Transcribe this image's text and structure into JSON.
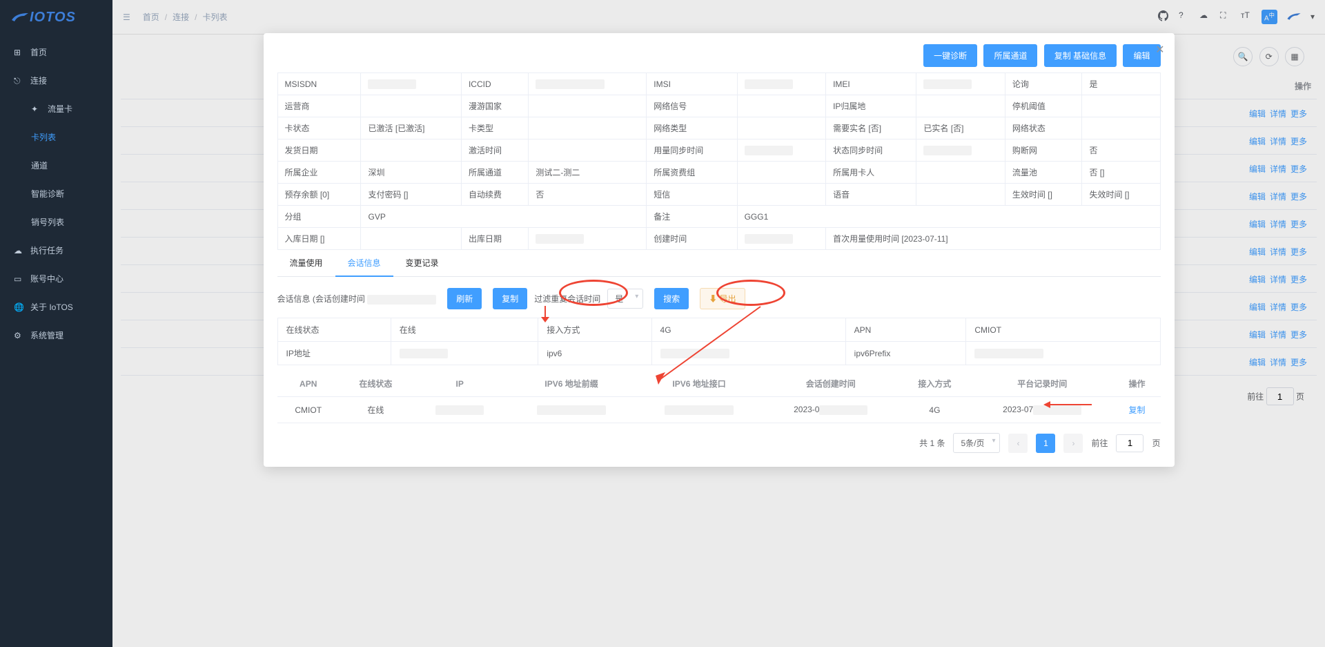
{
  "logo": "IOTOS",
  "sidebar": {
    "home": "首页",
    "connect": "连接",
    "flowcard": "流量卡",
    "cardlist": "卡列表",
    "channel": "通道",
    "diagnose": "智能诊断",
    "cancel_list": "销号列表",
    "tasks": "执行任务",
    "account": "账号中心",
    "about": "关于 IoTOS",
    "system": "系统管理"
  },
  "breadcrumb": {
    "home": "首页",
    "connect": "连接",
    "cardlist": "卡列表"
  },
  "bg": {
    "ops_header": "操作",
    "edit": "编辑",
    "detail": "详情",
    "more": "更多",
    "pagination_goto": "前往",
    "pagination_page_suffix": "页",
    "page_value": "1"
  },
  "modal": {
    "header_btns": {
      "diag": "一键诊断",
      "channel": "所属通道",
      "copy_base": "复制 基础信息",
      "edit": "编辑"
    },
    "info": {
      "msisdn_l": "MSISDN",
      "iccid_l": "ICCID",
      "imsi_l": "IMSI",
      "imei_l": "IMEI",
      "poll_l": "论询",
      "poll_v": "是",
      "carrier_l": "运营商",
      "roam_l": "漫游国家",
      "signal_l": "网络信号",
      "ipzone_l": "IP归属地",
      "shutdown_l": "停机阈值",
      "cardstate_l": "卡状态",
      "cardstate_v": "已激活 [已激活]",
      "cardtype_l": "卡类型",
      "nettype_l": "网络类型",
      "realname_l": "需要实名 [否]",
      "hasreal_l": "已实名 [否]",
      "netstate_l": "网络状态",
      "ship_l": "发货日期",
      "active_l": "激活时间",
      "usagesync_l": "用量同步时间",
      "statesync_l": "状态同步时间",
      "buycut_l": "购断网",
      "buycut_v": "否",
      "company_l": "所属企业",
      "company_v": "深圳",
      "channel_l": "所属通道",
      "channel_v": "测试二-测二",
      "feegroup_l": "所属资费组",
      "carduser_l": "所属用卡人",
      "pool_l": "流量池",
      "pool_v": "否 []",
      "balance_l": "预存余额 [0]",
      "paypwd_l": "支付密码 []",
      "autorenew_l": "自动续费",
      "autorenew_v": "否",
      "sms_l": "短信",
      "voice_l": "语音",
      "effect_l": "生效时间 []",
      "expire_l": "失效时间 []",
      "group_l": "分组",
      "group_v": "GVP",
      "remark_l": "备注",
      "remark_v": "GGG1",
      "instock_l": "入库日期 []",
      "outstock_l": "出库日期",
      "create_l": "创建时间",
      "firstuse_l": "首次用量使用时间 [2023-07-11]"
    },
    "tabs": {
      "usage": "流量使用",
      "session": "会话信息",
      "change": "变更记录"
    },
    "session_bar": {
      "label_prefix": "会话信息 (会话创建时间",
      "refresh": "刷新",
      "copy": "复制",
      "filter_label": "过滤重复会话时间",
      "filter_value": "是",
      "search": "搜索",
      "export": "导出"
    },
    "session_info": {
      "online_state_l": "在线状态",
      "online_state_v": "在线",
      "access_l": "接入方式",
      "access_v": "4G",
      "apn_l": "APN",
      "apn_v": "CMIOT",
      "ip_l": "IP地址",
      "ipv6_l": "ipv6",
      "ipv6prefix_l": "ipv6Prefix"
    },
    "table": {
      "headers": {
        "apn": "APN",
        "online": "在线状态",
        "ip": "IP",
        "ipv6prefix": "IPV6 地址前缀",
        "ipv6int": "IPV6 地址接口",
        "created": "会话创建时间",
        "access": "接入方式",
        "logged": "平台记录时间",
        "ops": "操作"
      },
      "row": {
        "apn": "CMIOT",
        "online": "在线",
        "created_p": "2023-0",
        "access": "4G",
        "logged_p": "2023-07",
        "copy": "复制"
      }
    },
    "pagination": {
      "total": "共 1 条",
      "per_page": "5条/页",
      "goto": "前往",
      "page_suffix": "页",
      "current": "1",
      "goto_value": "1"
    }
  }
}
